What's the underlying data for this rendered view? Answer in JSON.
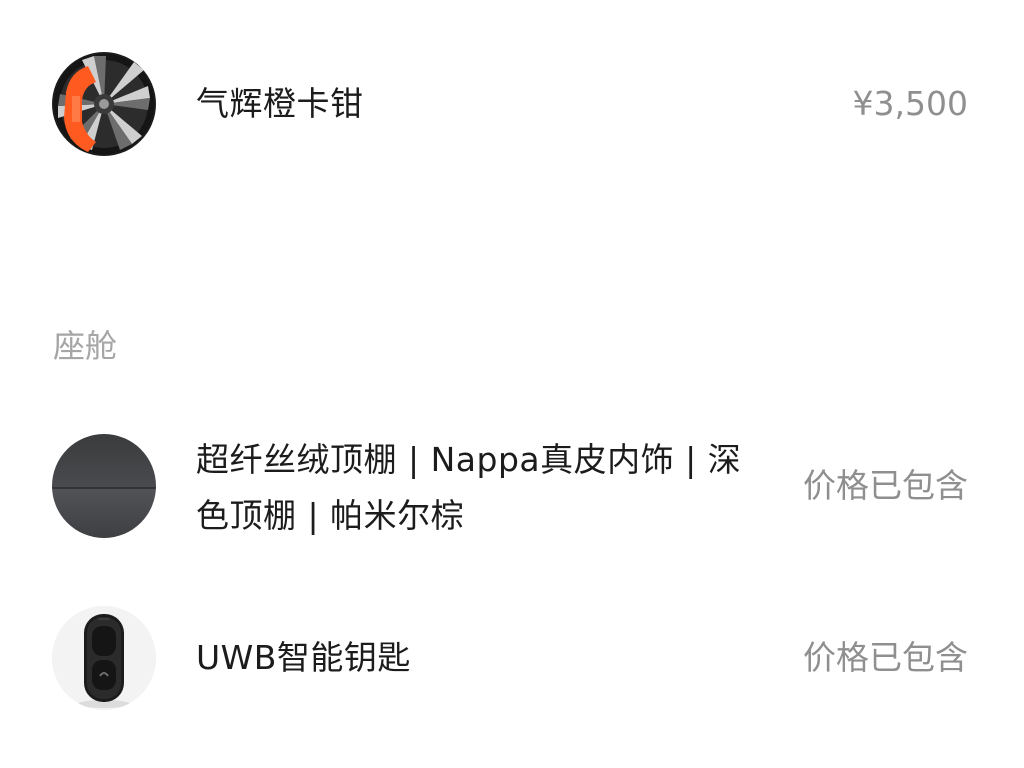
{
  "items_top": [
    {
      "name": "气辉橙卡钳",
      "price": "¥3,500",
      "icon": "orange-caliper-wheel"
    }
  ],
  "section": {
    "label": "座舱"
  },
  "cabin_items": [
    {
      "name_line1": "超纤丝绒顶棚 | Nappa真皮内饰 | 深",
      "name_line2": "色顶棚 | 帕米尔棕",
      "price": "价格已包含",
      "icon": "dark-headliner-swatch"
    },
    {
      "name": "UWB智能钥匙",
      "price": "价格已包含",
      "icon": "car-key-fob"
    }
  ],
  "colors": {
    "caliper_orange": "#ff5a1f",
    "muted_text": "#8f8f8f",
    "section_label": "#a6a6a6"
  }
}
